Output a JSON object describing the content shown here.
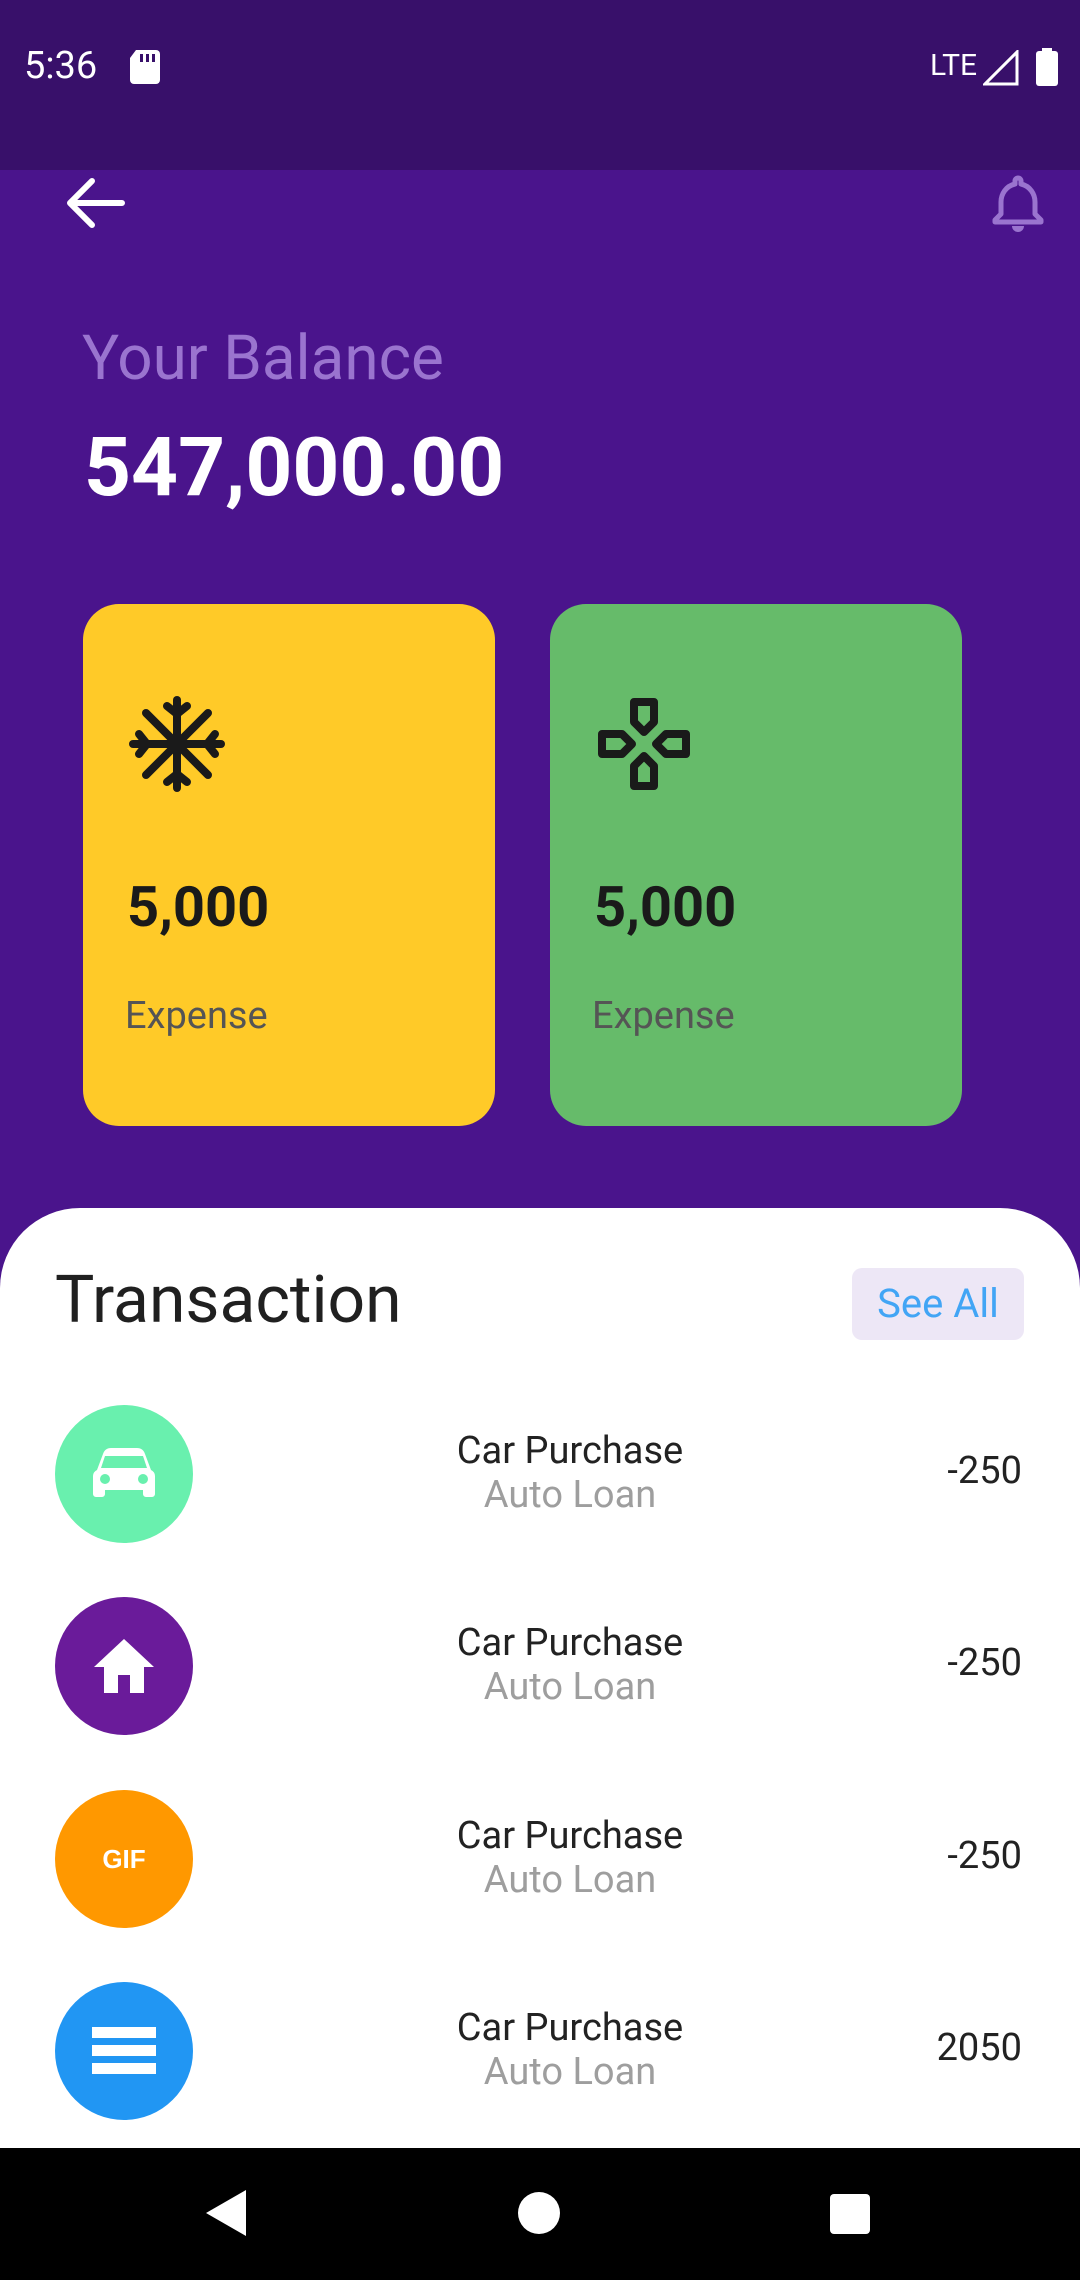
{
  "status": {
    "time": "5:36",
    "network": "LTE"
  },
  "header": {
    "balance_label": "Your Balance",
    "balance_value": "547,000.00"
  },
  "cards": [
    {
      "amount": "5,000",
      "label": "Expense",
      "icon": "snowflake-icon",
      "color": "#ffca28"
    },
    {
      "amount": "5,000",
      "label": "Expense",
      "icon": "gamepad-icon",
      "color": "#66bb6a"
    }
  ],
  "transactions": {
    "title": "Transaction",
    "see_all": "See All",
    "items": [
      {
        "title": "Car Purchase",
        "subtitle": "Auto Loan",
        "amount": "-250",
        "icon": "car-icon",
        "color": "#69f0ae"
      },
      {
        "title": "Car Purchase",
        "subtitle": "Auto Loan",
        "amount": "-250",
        "icon": "home-icon",
        "color": "#6a1b9a"
      },
      {
        "title": "Car Purchase",
        "subtitle": "Auto Loan",
        "amount": "-250",
        "icon": "gif-icon",
        "color": "#ff9800"
      },
      {
        "title": "Car Purchase",
        "subtitle": "Auto Loan",
        "amount": "2050",
        "icon": "menu-lines-icon",
        "color": "#2196f3"
      }
    ]
  }
}
